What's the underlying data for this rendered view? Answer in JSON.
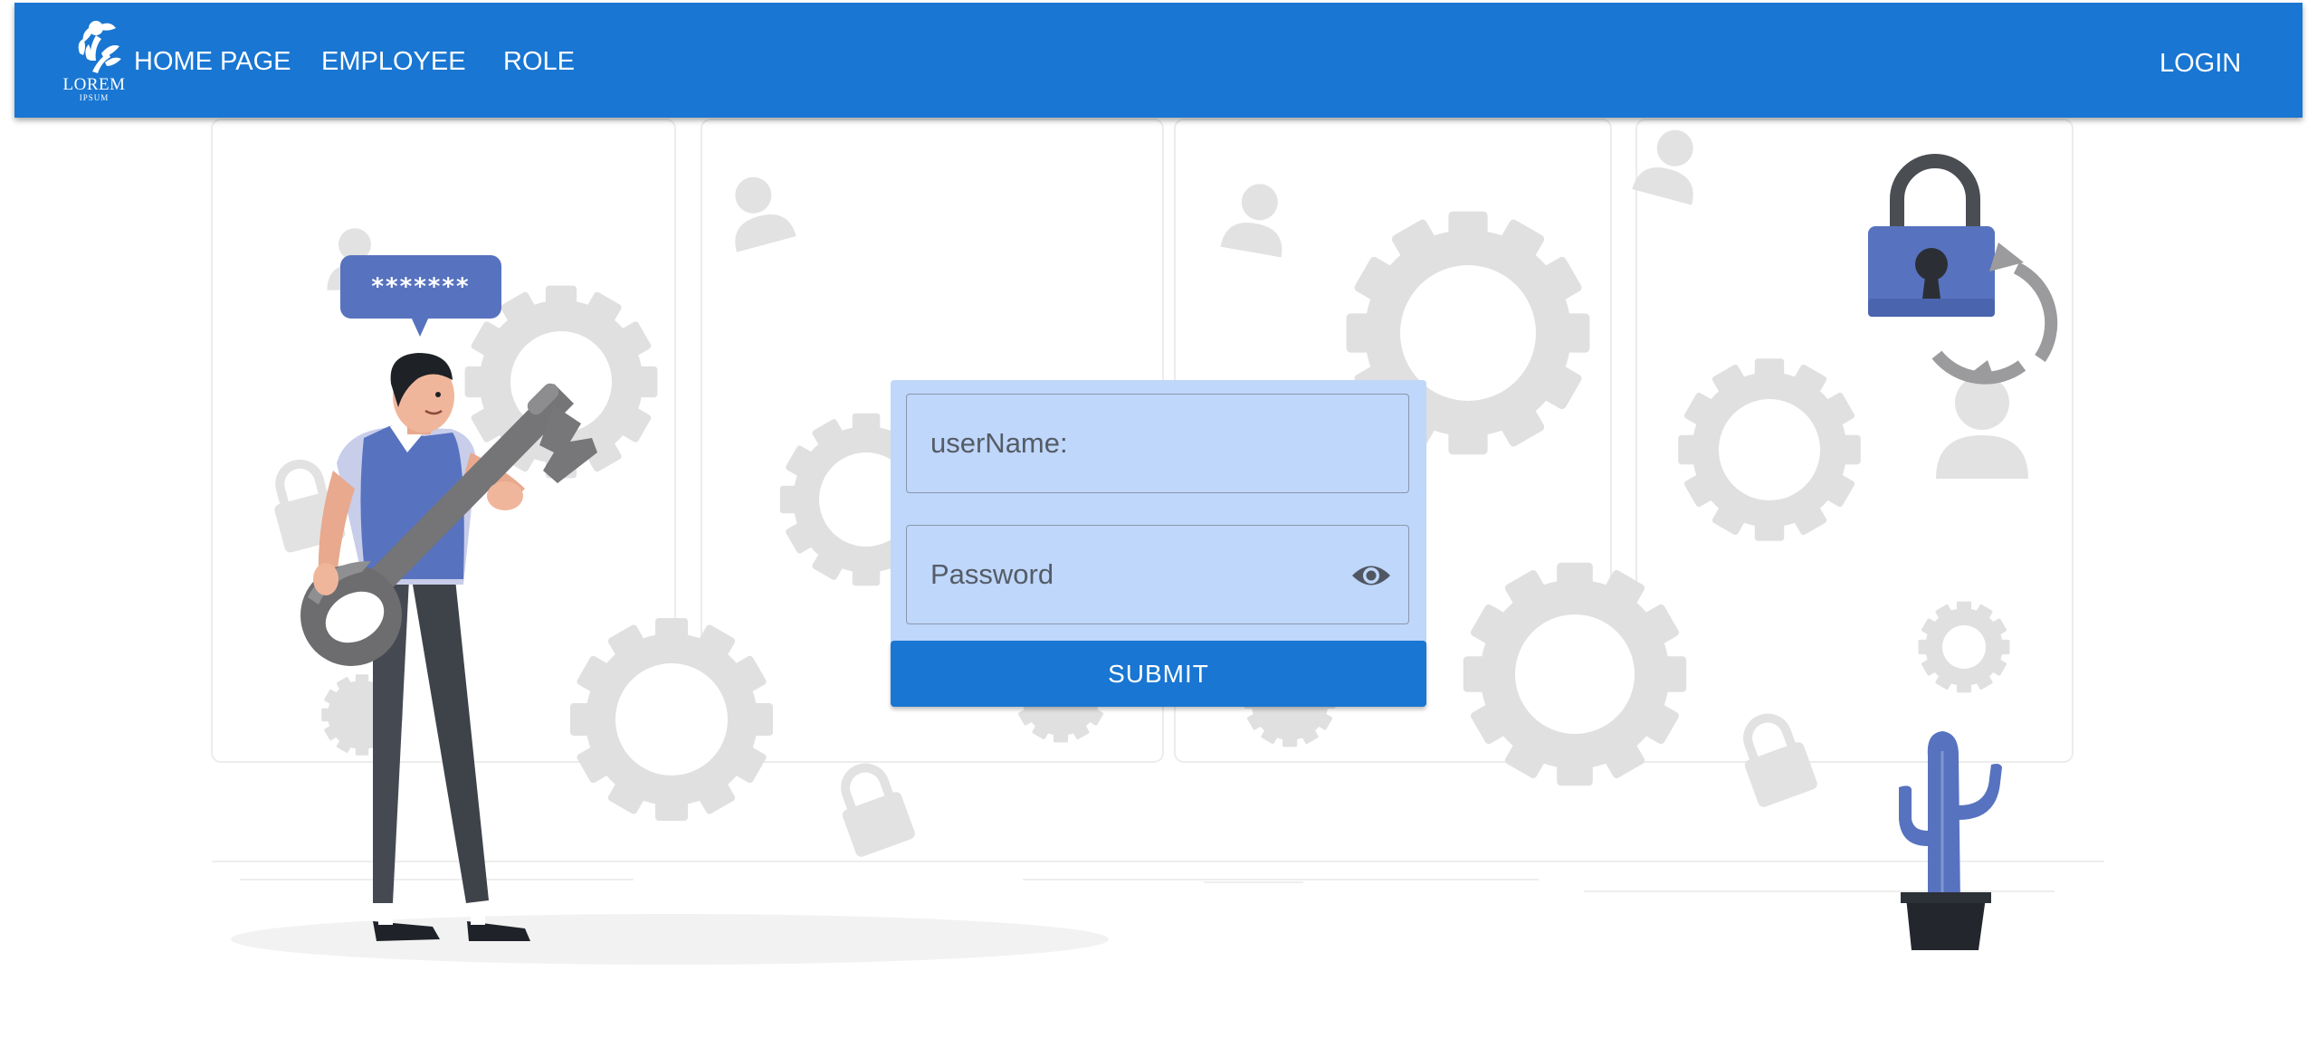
{
  "header": {
    "logo_text": "LOREM",
    "logo_subtext": "IPSUM",
    "nav": [
      {
        "label": "HOME PAGE"
      },
      {
        "label": "EMPLOYEE"
      },
      {
        "label": "ROLE"
      }
    ],
    "login_label": "LOGIN"
  },
  "illustration": {
    "speech_bubble": "*******"
  },
  "login_form": {
    "username_placeholder": "userName:",
    "password_placeholder": "Password",
    "submit_label": "SUBMIT"
  },
  "colors": {
    "primary": "#1976d2",
    "form_background": "#bfd7fb",
    "illustration_accent": "#5772bf"
  }
}
